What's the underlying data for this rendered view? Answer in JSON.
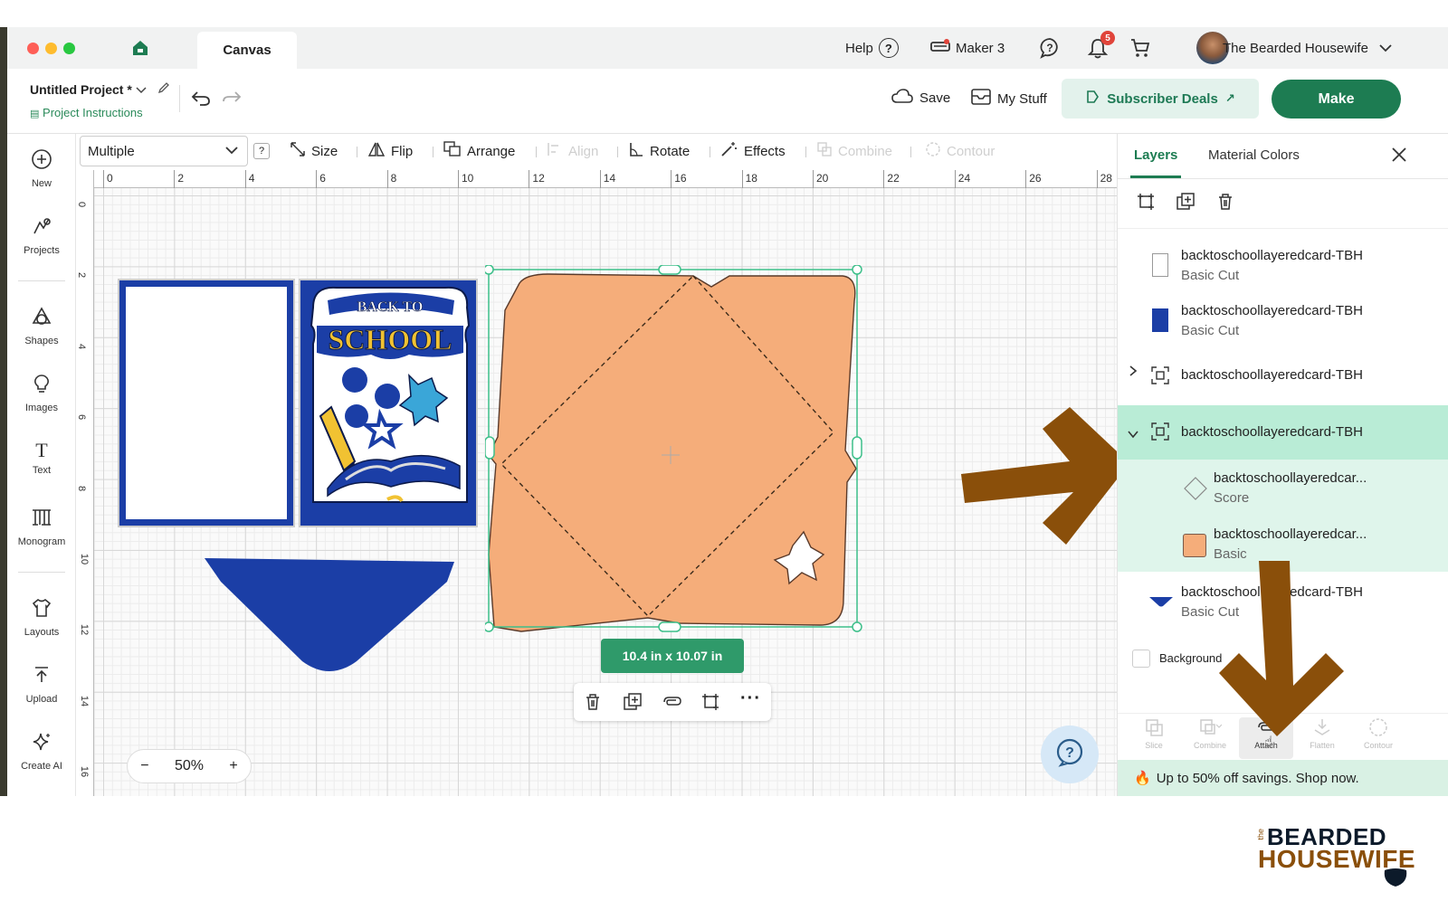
{
  "window": {
    "tab_title": "Canvas",
    "help_label": "Help",
    "machine_label": "Maker 3",
    "notification_count": "5",
    "user_name": "The Bearded Housewife"
  },
  "project": {
    "title": "Untitled Project *",
    "instructions_link": "Project Instructions",
    "save_label": "Save",
    "my_stuff_label": "My Stuff",
    "subscriber_label": "Subscriber Deals",
    "make_label": "Make"
  },
  "sidebar": {
    "items": [
      {
        "label": "New",
        "icon": "plus-circle-icon"
      },
      {
        "label": "Projects",
        "icon": "projects-icon"
      },
      {
        "label": "Shapes",
        "icon": "shapes-icon"
      },
      {
        "label": "Images",
        "icon": "lightbulb-icon"
      },
      {
        "label": "Text",
        "icon": "text-icon"
      },
      {
        "label": "Monogram",
        "icon": "monogram-icon"
      },
      {
        "label": "Layouts",
        "icon": "shirt-icon"
      },
      {
        "label": "Upload",
        "icon": "upload-icon"
      },
      {
        "label": "Create AI",
        "icon": "sparkle-icon"
      }
    ]
  },
  "toolbar": {
    "selection_value": "Multiple",
    "help_badge": "?",
    "size_label": "Size",
    "flip_label": "Flip",
    "arrange_label": "Arrange",
    "align_label": "Align",
    "rotate_label": "Rotate",
    "effects_label": "Effects",
    "combine_label": "Combine",
    "contour_label": "Contour"
  },
  "canvas": {
    "ruler_top": [
      "0",
      "2",
      "4",
      "6",
      "8",
      "10",
      "12",
      "14",
      "16",
      "18",
      "20",
      "22",
      "24",
      "26",
      "28"
    ],
    "ruler_left": [
      "0",
      "2",
      "4",
      "6",
      "8",
      "10",
      "12",
      "14",
      "16"
    ],
    "card_text_top": "BACK TO",
    "card_text_main": "SCHOOL",
    "dimension_label": "10.4  in x 10.07  in",
    "zoom_label": "50%",
    "zoom_minus": "−",
    "zoom_plus": "+"
  },
  "panel": {
    "tab_layers": "Layers",
    "tab_material": "Material Colors",
    "layers": [
      {
        "name": "backtoschoollayeredcard-TBH",
        "sub": "Basic Cut"
      },
      {
        "name": "backtoschoollayeredcard-TBH",
        "sub": "Basic Cut"
      },
      {
        "name": "backtoschoollayeredcard-TBH",
        "sub": ""
      },
      {
        "name": "backtoschoollayeredcard-TBH",
        "sub": ""
      },
      {
        "name": "backtoschoollayeredcar...",
        "sub": "Score"
      },
      {
        "name": "backtoschoollayeredcar...",
        "sub": "Basic"
      },
      {
        "name": "backtoschoollayeredcard-TBH",
        "sub": "Basic Cut"
      }
    ],
    "background_label": "Background",
    "bottom_tools": [
      "Slice",
      "Combine",
      "Attach",
      "Flatten",
      "Contour"
    ],
    "promo_text": "Up to 50% off savings. Shop now."
  },
  "branding": {
    "logo_small": "the",
    "logo_line1": "BEARDED",
    "logo_line2": "HOUSEWIFE"
  },
  "colors": {
    "brand_green": "#1d7c52",
    "arrow_brown": "#8a4f0a",
    "envelope": "#f5ad7a",
    "card_blue": "#1b3ea6",
    "selection_green": "#3dbf8a"
  }
}
